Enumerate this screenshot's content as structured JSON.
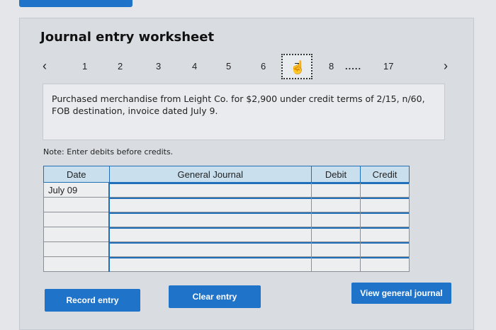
{
  "worksheet": {
    "title": "Journal entry worksheet",
    "pager": {
      "prev_icon": "‹",
      "next_icon": "›",
      "pages": [
        "1",
        "2",
        "3",
        "4",
        "5",
        "6",
        "7",
        "8"
      ],
      "ellipsis": ".....",
      "last_page": "17",
      "current_page": "7"
    },
    "prompt": "Purchased merchandise from Leight Co. for $2,900 under credit terms of 2/15, n/60, FOB destination, invoice dated July 9.",
    "note": "Note: Enter debits before credits."
  },
  "table": {
    "headers": {
      "date": "Date",
      "journal": "General Journal",
      "debit": "Debit",
      "credit": "Credit"
    },
    "rows": [
      {
        "date": "July 09",
        "account": "",
        "debit": "",
        "credit": ""
      },
      {
        "date": "",
        "account": "",
        "debit": "",
        "credit": ""
      },
      {
        "date": "",
        "account": "",
        "debit": "",
        "credit": ""
      },
      {
        "date": "",
        "account": "",
        "debit": "",
        "credit": ""
      },
      {
        "date": "",
        "account": "",
        "debit": "",
        "credit": ""
      },
      {
        "date": "",
        "account": "",
        "debit": "",
        "credit": ""
      }
    ]
  },
  "buttons": {
    "record": "Record entry",
    "clear": "Clear entry",
    "view": "View general journal"
  },
  "colors": {
    "accent": "#1f73c9",
    "header_bg": "#c9dfee",
    "panel_bg": "#d9dde2"
  }
}
